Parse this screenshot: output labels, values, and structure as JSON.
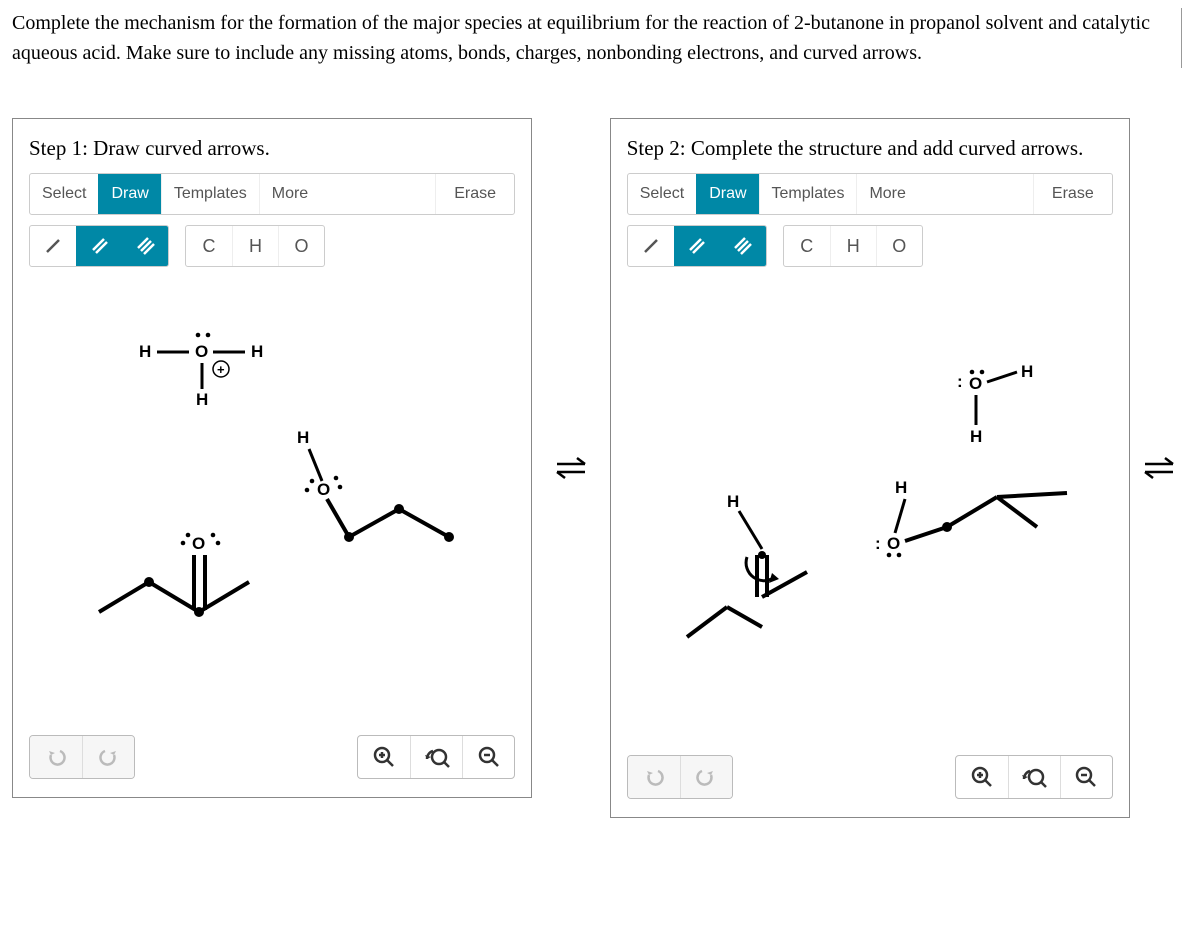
{
  "question": "Complete the mechanism for the formation of the major species at equilibrium for the reaction of 2-butanone in propanol solvent and catalytic aqueous acid. Make sure to include any missing atoms, bonds, charges, nonbonding electrons, and curved arrows.",
  "step1": {
    "title": "Step 1: Draw curved arrows.",
    "toolbar": {
      "select": "Select",
      "draw": "Draw",
      "templates": "Templates",
      "more": "More",
      "erase": "Erase"
    },
    "atoms": [
      "C",
      "H",
      "O"
    ]
  },
  "step2": {
    "title": "Step 2: Complete the structure and add curved arrows.",
    "toolbar": {
      "select": "Select",
      "draw": "Draw",
      "templates": "Templates",
      "more": "More",
      "erase": "Erase"
    },
    "atoms": [
      "C",
      "H",
      "O"
    ]
  },
  "icons": {
    "single": "single-bond-icon",
    "double": "double-bond-icon",
    "triple": "triple-bond-icon",
    "undo": "undo-icon",
    "redo": "redo-icon",
    "zoom_in": "zoom-in-icon",
    "zoom_reset": "zoom-reset-icon",
    "zoom_out": "zoom-out-icon"
  },
  "chart_data": null
}
